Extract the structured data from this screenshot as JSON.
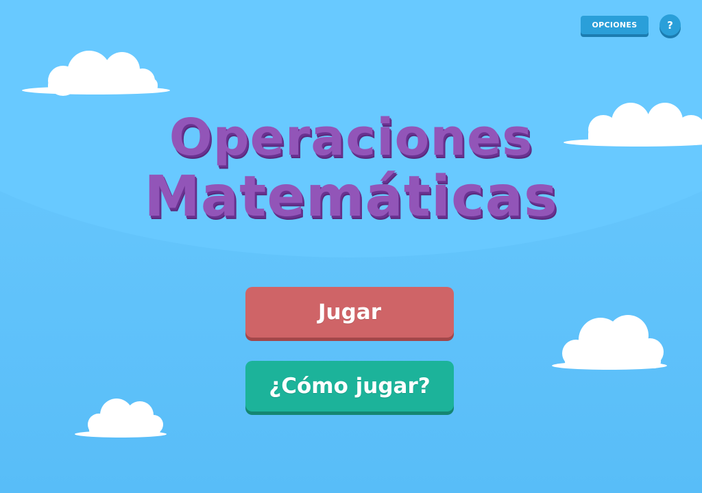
{
  "header": {
    "options_label": "OPCIONES",
    "help_label": "?"
  },
  "title": {
    "line1": "Operaciones",
    "line2": "Matemáticas"
  },
  "menu": {
    "play_label": "Jugar",
    "how_to_play_label": "¿Cómo jugar?"
  },
  "colors": {
    "sky": "#63c4fb",
    "title": "#9255b8",
    "play_button": "#cf6467",
    "how_to_play_button": "#1cb39a",
    "top_buttons": "#2a9fd9"
  }
}
